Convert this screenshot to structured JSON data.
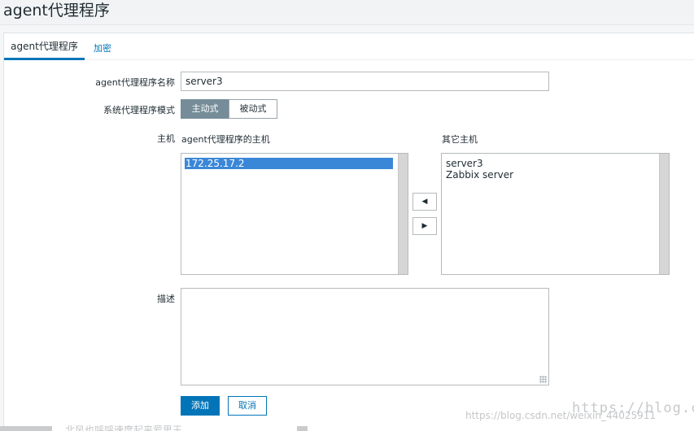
{
  "page": {
    "title": "agent代理程序"
  },
  "tabs": [
    {
      "label": "agent代理程序"
    },
    {
      "label": "加密"
    }
  ],
  "form": {
    "name_label": "agent代理程序名称",
    "name_value": "server3",
    "mode_label": "系统代理程序模式",
    "mode_options": [
      {
        "label": "主动式",
        "selected": true
      },
      {
        "label": "被动式",
        "selected": false
      }
    ],
    "hosts_label": "主机",
    "proxy_hosts_header": "agent代理程序的主机",
    "proxy_hosts": [
      "172.25.17.2"
    ],
    "other_hosts_header": "其它主机",
    "other_hosts": [
      "server3",
      "Zabbix server"
    ],
    "move_left_glyph": "◀",
    "move_right_glyph": "▶",
    "description_label": "描述",
    "description_value": ""
  },
  "actions": {
    "add_label": "添加",
    "cancel_label": "取消"
  },
  "watermarks": {
    "blog_text": "https://blog.cs",
    "csdn_url": "https://blog.csdn.net/weixin_44025911",
    "footer_text": "北风也呼呼速度起来爱思王"
  },
  "colors": {
    "accent": "#0275b8",
    "mode_active_bg": "#768d99",
    "selection_bg": "#3a87d8"
  }
}
